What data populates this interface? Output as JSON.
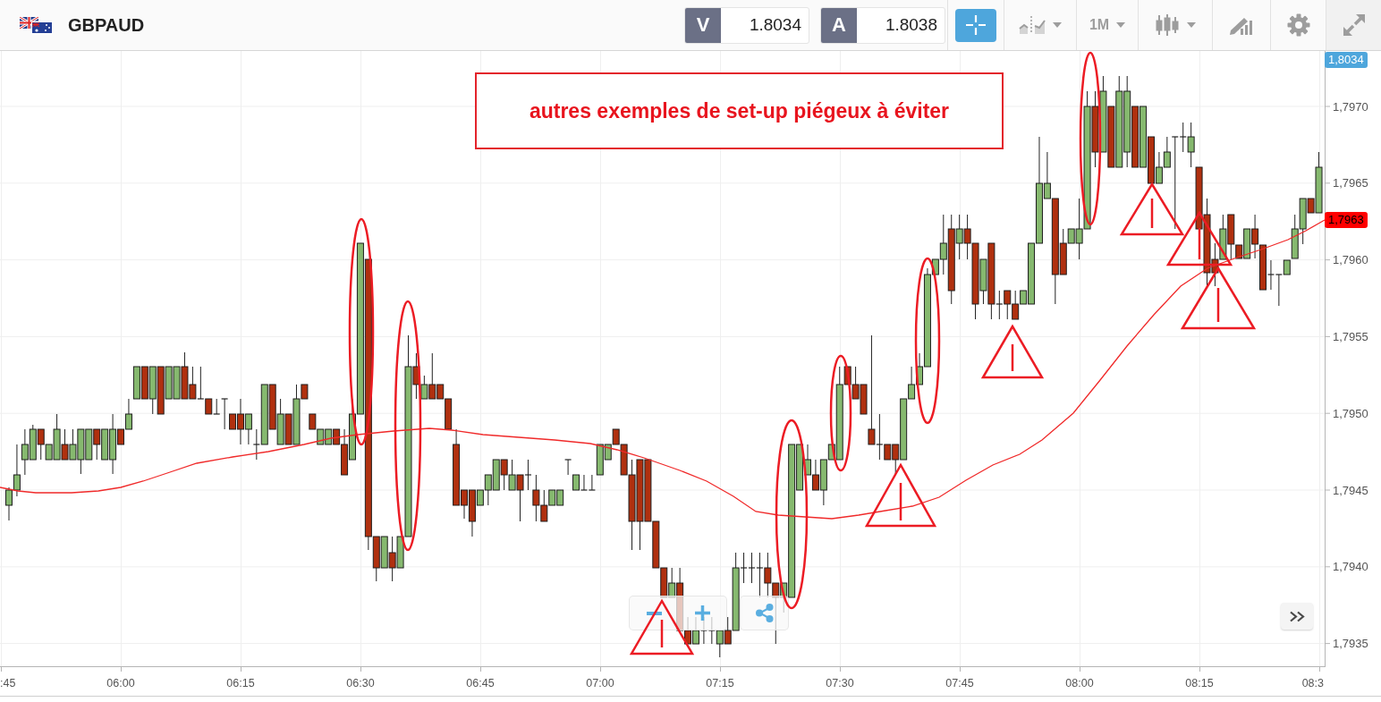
{
  "header": {
    "symbol": "GBPAUD",
    "quotes": [
      {
        "label": "V",
        "value": "1.8034"
      },
      {
        "label": "A",
        "value": "1.8038"
      }
    ],
    "tools": [
      {
        "kind": "crosshair",
        "active": true
      },
      {
        "kind": "chart-style",
        "active": false
      },
      {
        "kind": "timeframe",
        "label": "1M",
        "active": false
      },
      {
        "kind": "candle-type",
        "active": false
      },
      {
        "kind": "drawing",
        "active": false
      },
      {
        "kind": "settings",
        "active": false
      },
      {
        "kind": "fullscreen",
        "active": false
      }
    ]
  },
  "chart": {
    "note": "autres exemples de set-up piégeux à éviter",
    "price_ticks": [
      "1,7970",
      "1,7965",
      "1,7960",
      "1,7955",
      "1,7950",
      "1,7945",
      "1,7940",
      "1,7935"
    ],
    "price_markers": [
      {
        "kind": "bid",
        "label": "1,8034",
        "color": "#4ea6dc"
      },
      {
        "kind": "average",
        "label": "1,7963",
        "color": "#ff0000"
      }
    ],
    "time_ticks": [
      ":45",
      "06:00",
      "06:15",
      "06:30",
      "06:45",
      "07:00",
      "07:15",
      "07:30",
      "07:45",
      "08:00",
      "08:15",
      "08:3"
    ]
  }
}
